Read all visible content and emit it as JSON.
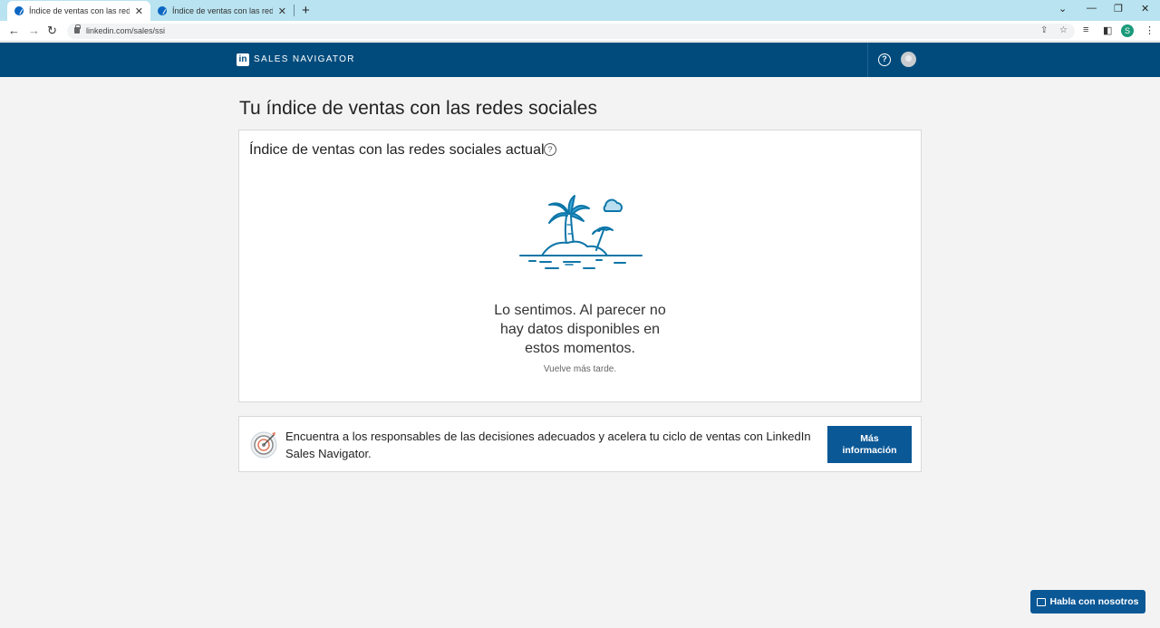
{
  "browser": {
    "tabs": [
      {
        "title": "Índice de ventas con las redes so",
        "active": true
      },
      {
        "title": "Índice de ventas con las redes so",
        "active": false
      }
    ],
    "url": "linkedin.com/sales/ssi",
    "profile_initial": "S"
  },
  "header": {
    "logo": "in",
    "brand": "SALES NAVIGATOR",
    "help_symbol": "?"
  },
  "main": {
    "page_title": "Tu índice de ventas con las redes sociales",
    "card": {
      "title": "Índice de ventas con las redes sociales actual",
      "help_symbol": "?",
      "empty_message": "Lo sentimos. Al parecer no hay datos disponibles en estos momentos.",
      "empty_subtext": "Vuelve más tarde."
    },
    "promo": {
      "text": "Encuentra a los responsables de las decisiones adecuados y acelera tu ciclo de ventas con LinkedIn Sales Navigator.",
      "button_label": "Más información"
    }
  },
  "chat": {
    "label": "Habla con nosotros"
  },
  "colors": {
    "tab_strip": "#b9e3f0",
    "header_bg": "#004b7c",
    "button_bg": "#0b5896",
    "illustration_blue": "#0e76a8"
  }
}
